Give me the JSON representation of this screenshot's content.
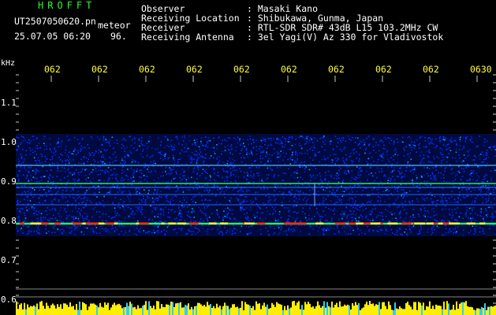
{
  "header": {
    "title": "HROFFT",
    "filename": "UT2507050620.pn",
    "tag": "meteor",
    "datetime": "25.07.05 06:20",
    "count": "96."
  },
  "info": [
    {
      "label": "Observer",
      "value": ": Masaki Kano"
    },
    {
      "label": "Receiving Location",
      "value": ": Shibukawa, Gunma, Japan"
    },
    {
      "label": "Receiver",
      "value": ": RTL-SDR SDR# 43dB L15 103.2MHz CW"
    },
    {
      "label": "Receiving Antenna",
      "value": ": 3el Yagi(V) Az 330 for Vladivostok"
    }
  ],
  "axis": {
    "unit": "kHz",
    "time_labels": [
      "062",
      "062",
      "062",
      "062",
      "062",
      "062",
      "062",
      "062",
      "062",
      "0630"
    ],
    "freq_labels": [
      "1.1",
      "1.0",
      "0.9",
      "0.8",
      "0.7",
      "0.6"
    ]
  },
  "colors": {
    "title_green": "#22ff22",
    "time_yellow": "#ffff33",
    "noise_blue": "#0033ff",
    "signal_green": "#33ff66",
    "signal_red": "#ff3300",
    "bar_yellow": "#ffee00"
  }
}
